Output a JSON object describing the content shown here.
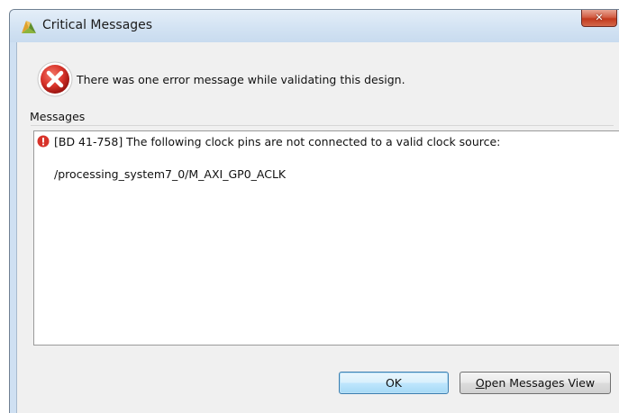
{
  "window": {
    "title": "Critical Messages",
    "close_label": "✕"
  },
  "dialog": {
    "header_message": "There was one error message while validating this design.",
    "messages_label": "Messages"
  },
  "messages": [
    {
      "severity": "error",
      "text": "[BD 41-758] The following clock pins are not connected to a valid clock source:",
      "detail": "/processing_system7_0/M_AXI_GP0_ACLK"
    }
  ],
  "buttons": {
    "ok_label": "OK",
    "open_messages_mnemonic": "O",
    "open_messages_rest": "pen Messages View"
  },
  "colors": {
    "error_red": "#d8332a",
    "title_bar": "#d3e3f3",
    "dialog_bg": "#f0f0f0"
  },
  "icons": {
    "title": "vivado-logo-icon",
    "header": "error-x-icon",
    "message": "error-exclamation-icon"
  }
}
